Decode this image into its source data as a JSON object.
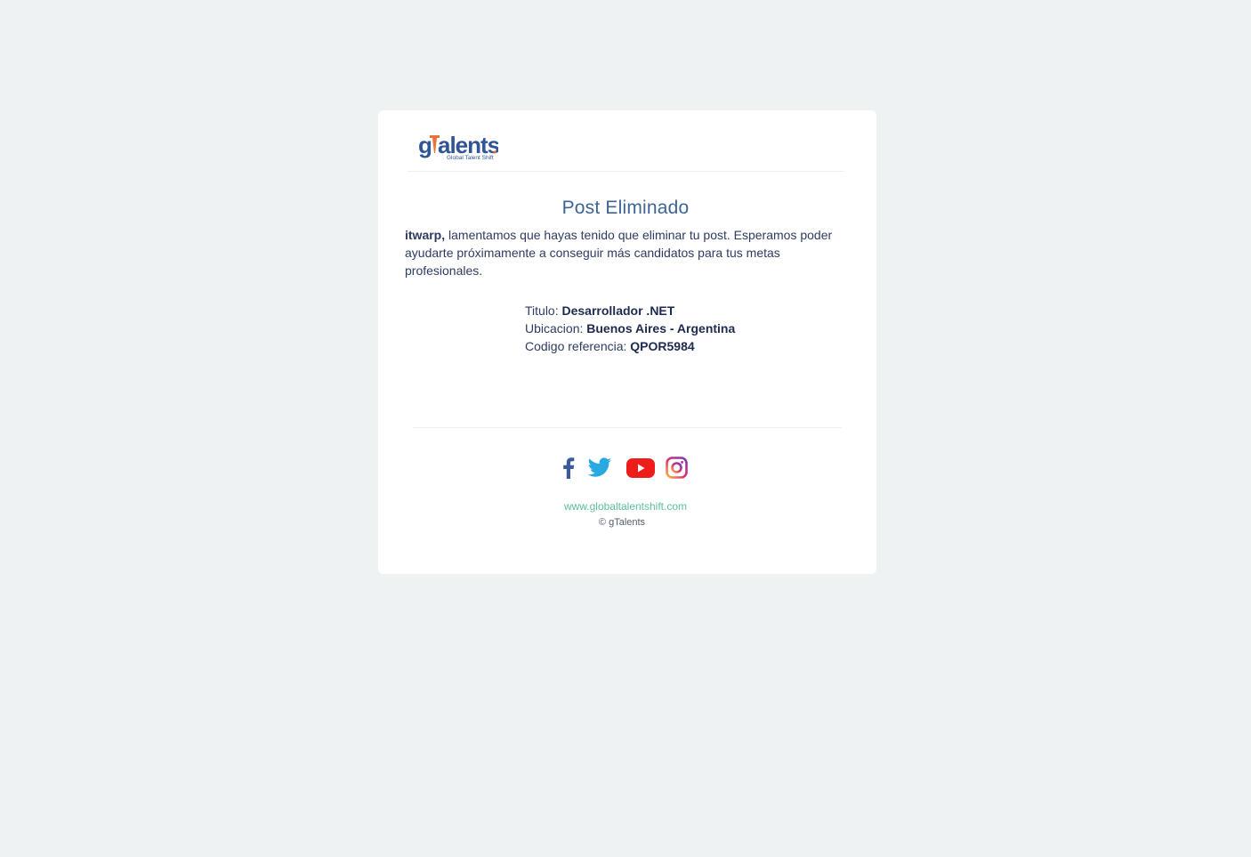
{
  "header": {
    "logo_text": "gTalents",
    "logo_tagline": "Global Talent Shift"
  },
  "main": {
    "title": "Post Eliminado",
    "username": "itwarp,",
    "message": " lamentamos que hayas tenido que eliminar tu post. Esperamos poder ayudarte próximamente a conseguir más candidatos para tus metas profesionales."
  },
  "details": {
    "titulo_label": "Titulo: ",
    "titulo_value": "Desarrollador .NET",
    "ubicacion_label": "Ubicacion: ",
    "ubicacion_value": "Buenos Aires - Argentina",
    "codigo_label": "Codigo referencia: ",
    "codigo_value": "QPOR5984"
  },
  "footer": {
    "social_icons": [
      "facebook-icon",
      "twitter-icon",
      "youtube-icon",
      "instagram-icon"
    ],
    "site_link": "www.globaltalentshift.com",
    "copyright": "© gTalents"
  },
  "colors": {
    "page_background": "#eef2f3",
    "title": "#3d6494",
    "link": "#5cbf9a",
    "brand_blue": "#2f5597",
    "brand_orange": "#e8743b"
  }
}
